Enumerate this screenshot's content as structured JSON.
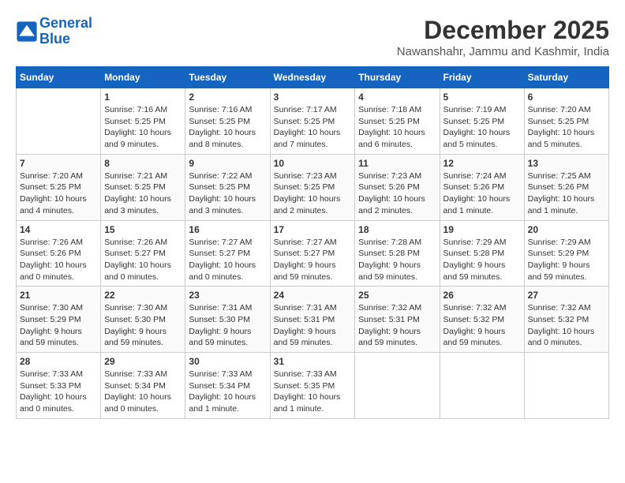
{
  "header": {
    "logo_line1": "General",
    "logo_line2": "Blue",
    "month_title": "December 2025",
    "location": "Nawanshahr, Jammu and Kashmir, India"
  },
  "weekdays": [
    "Sunday",
    "Monday",
    "Tuesday",
    "Wednesday",
    "Thursday",
    "Friday",
    "Saturday"
  ],
  "weeks": [
    [
      {
        "day": "",
        "info": ""
      },
      {
        "day": "1",
        "info": "Sunrise: 7:16 AM\nSunset: 5:25 PM\nDaylight: 10 hours\nand 9 minutes."
      },
      {
        "day": "2",
        "info": "Sunrise: 7:16 AM\nSunset: 5:25 PM\nDaylight: 10 hours\nand 8 minutes."
      },
      {
        "day": "3",
        "info": "Sunrise: 7:17 AM\nSunset: 5:25 PM\nDaylight: 10 hours\nand 7 minutes."
      },
      {
        "day": "4",
        "info": "Sunrise: 7:18 AM\nSunset: 5:25 PM\nDaylight: 10 hours\nand 6 minutes."
      },
      {
        "day": "5",
        "info": "Sunrise: 7:19 AM\nSunset: 5:25 PM\nDaylight: 10 hours\nand 5 minutes."
      },
      {
        "day": "6",
        "info": "Sunrise: 7:20 AM\nSunset: 5:25 PM\nDaylight: 10 hours\nand 5 minutes."
      }
    ],
    [
      {
        "day": "7",
        "info": "Sunrise: 7:20 AM\nSunset: 5:25 PM\nDaylight: 10 hours\nand 4 minutes."
      },
      {
        "day": "8",
        "info": "Sunrise: 7:21 AM\nSunset: 5:25 PM\nDaylight: 10 hours\nand 3 minutes."
      },
      {
        "day": "9",
        "info": "Sunrise: 7:22 AM\nSunset: 5:25 PM\nDaylight: 10 hours\nand 3 minutes."
      },
      {
        "day": "10",
        "info": "Sunrise: 7:23 AM\nSunset: 5:25 PM\nDaylight: 10 hours\nand 2 minutes."
      },
      {
        "day": "11",
        "info": "Sunrise: 7:23 AM\nSunset: 5:26 PM\nDaylight: 10 hours\nand 2 minutes."
      },
      {
        "day": "12",
        "info": "Sunrise: 7:24 AM\nSunset: 5:26 PM\nDaylight: 10 hours\nand 1 minute."
      },
      {
        "day": "13",
        "info": "Sunrise: 7:25 AM\nSunset: 5:26 PM\nDaylight: 10 hours\nand 1 minute."
      }
    ],
    [
      {
        "day": "14",
        "info": "Sunrise: 7:26 AM\nSunset: 5:26 PM\nDaylight: 10 hours\nand 0 minutes."
      },
      {
        "day": "15",
        "info": "Sunrise: 7:26 AM\nSunset: 5:27 PM\nDaylight: 10 hours\nand 0 minutes."
      },
      {
        "day": "16",
        "info": "Sunrise: 7:27 AM\nSunset: 5:27 PM\nDaylight: 10 hours\nand 0 minutes."
      },
      {
        "day": "17",
        "info": "Sunrise: 7:27 AM\nSunset: 5:27 PM\nDaylight: 9 hours\nand 59 minutes."
      },
      {
        "day": "18",
        "info": "Sunrise: 7:28 AM\nSunset: 5:28 PM\nDaylight: 9 hours\nand 59 minutes."
      },
      {
        "day": "19",
        "info": "Sunrise: 7:29 AM\nSunset: 5:28 PM\nDaylight: 9 hours\nand 59 minutes."
      },
      {
        "day": "20",
        "info": "Sunrise: 7:29 AM\nSunset: 5:29 PM\nDaylight: 9 hours\nand 59 minutes."
      }
    ],
    [
      {
        "day": "21",
        "info": "Sunrise: 7:30 AM\nSunset: 5:29 PM\nDaylight: 9 hours\nand 59 minutes."
      },
      {
        "day": "22",
        "info": "Sunrise: 7:30 AM\nSunset: 5:30 PM\nDaylight: 9 hours\nand 59 minutes."
      },
      {
        "day": "23",
        "info": "Sunrise: 7:31 AM\nSunset: 5:30 PM\nDaylight: 9 hours\nand 59 minutes."
      },
      {
        "day": "24",
        "info": "Sunrise: 7:31 AM\nSunset: 5:31 PM\nDaylight: 9 hours\nand 59 minutes."
      },
      {
        "day": "25",
        "info": "Sunrise: 7:32 AM\nSunset: 5:31 PM\nDaylight: 9 hours\nand 59 minutes."
      },
      {
        "day": "26",
        "info": "Sunrise: 7:32 AM\nSunset: 5:32 PM\nDaylight: 9 hours\nand 59 minutes."
      },
      {
        "day": "27",
        "info": "Sunrise: 7:32 AM\nSunset: 5:32 PM\nDaylight: 10 hours\nand 0 minutes."
      }
    ],
    [
      {
        "day": "28",
        "info": "Sunrise: 7:33 AM\nSunset: 5:33 PM\nDaylight: 10 hours\nand 0 minutes."
      },
      {
        "day": "29",
        "info": "Sunrise: 7:33 AM\nSunset: 5:34 PM\nDaylight: 10 hours\nand 0 minutes."
      },
      {
        "day": "30",
        "info": "Sunrise: 7:33 AM\nSunset: 5:34 PM\nDaylight: 10 hours\nand 1 minute."
      },
      {
        "day": "31",
        "info": "Sunrise: 7:33 AM\nSunset: 5:35 PM\nDaylight: 10 hours\nand 1 minute."
      },
      {
        "day": "",
        "info": ""
      },
      {
        "day": "",
        "info": ""
      },
      {
        "day": "",
        "info": ""
      }
    ]
  ]
}
